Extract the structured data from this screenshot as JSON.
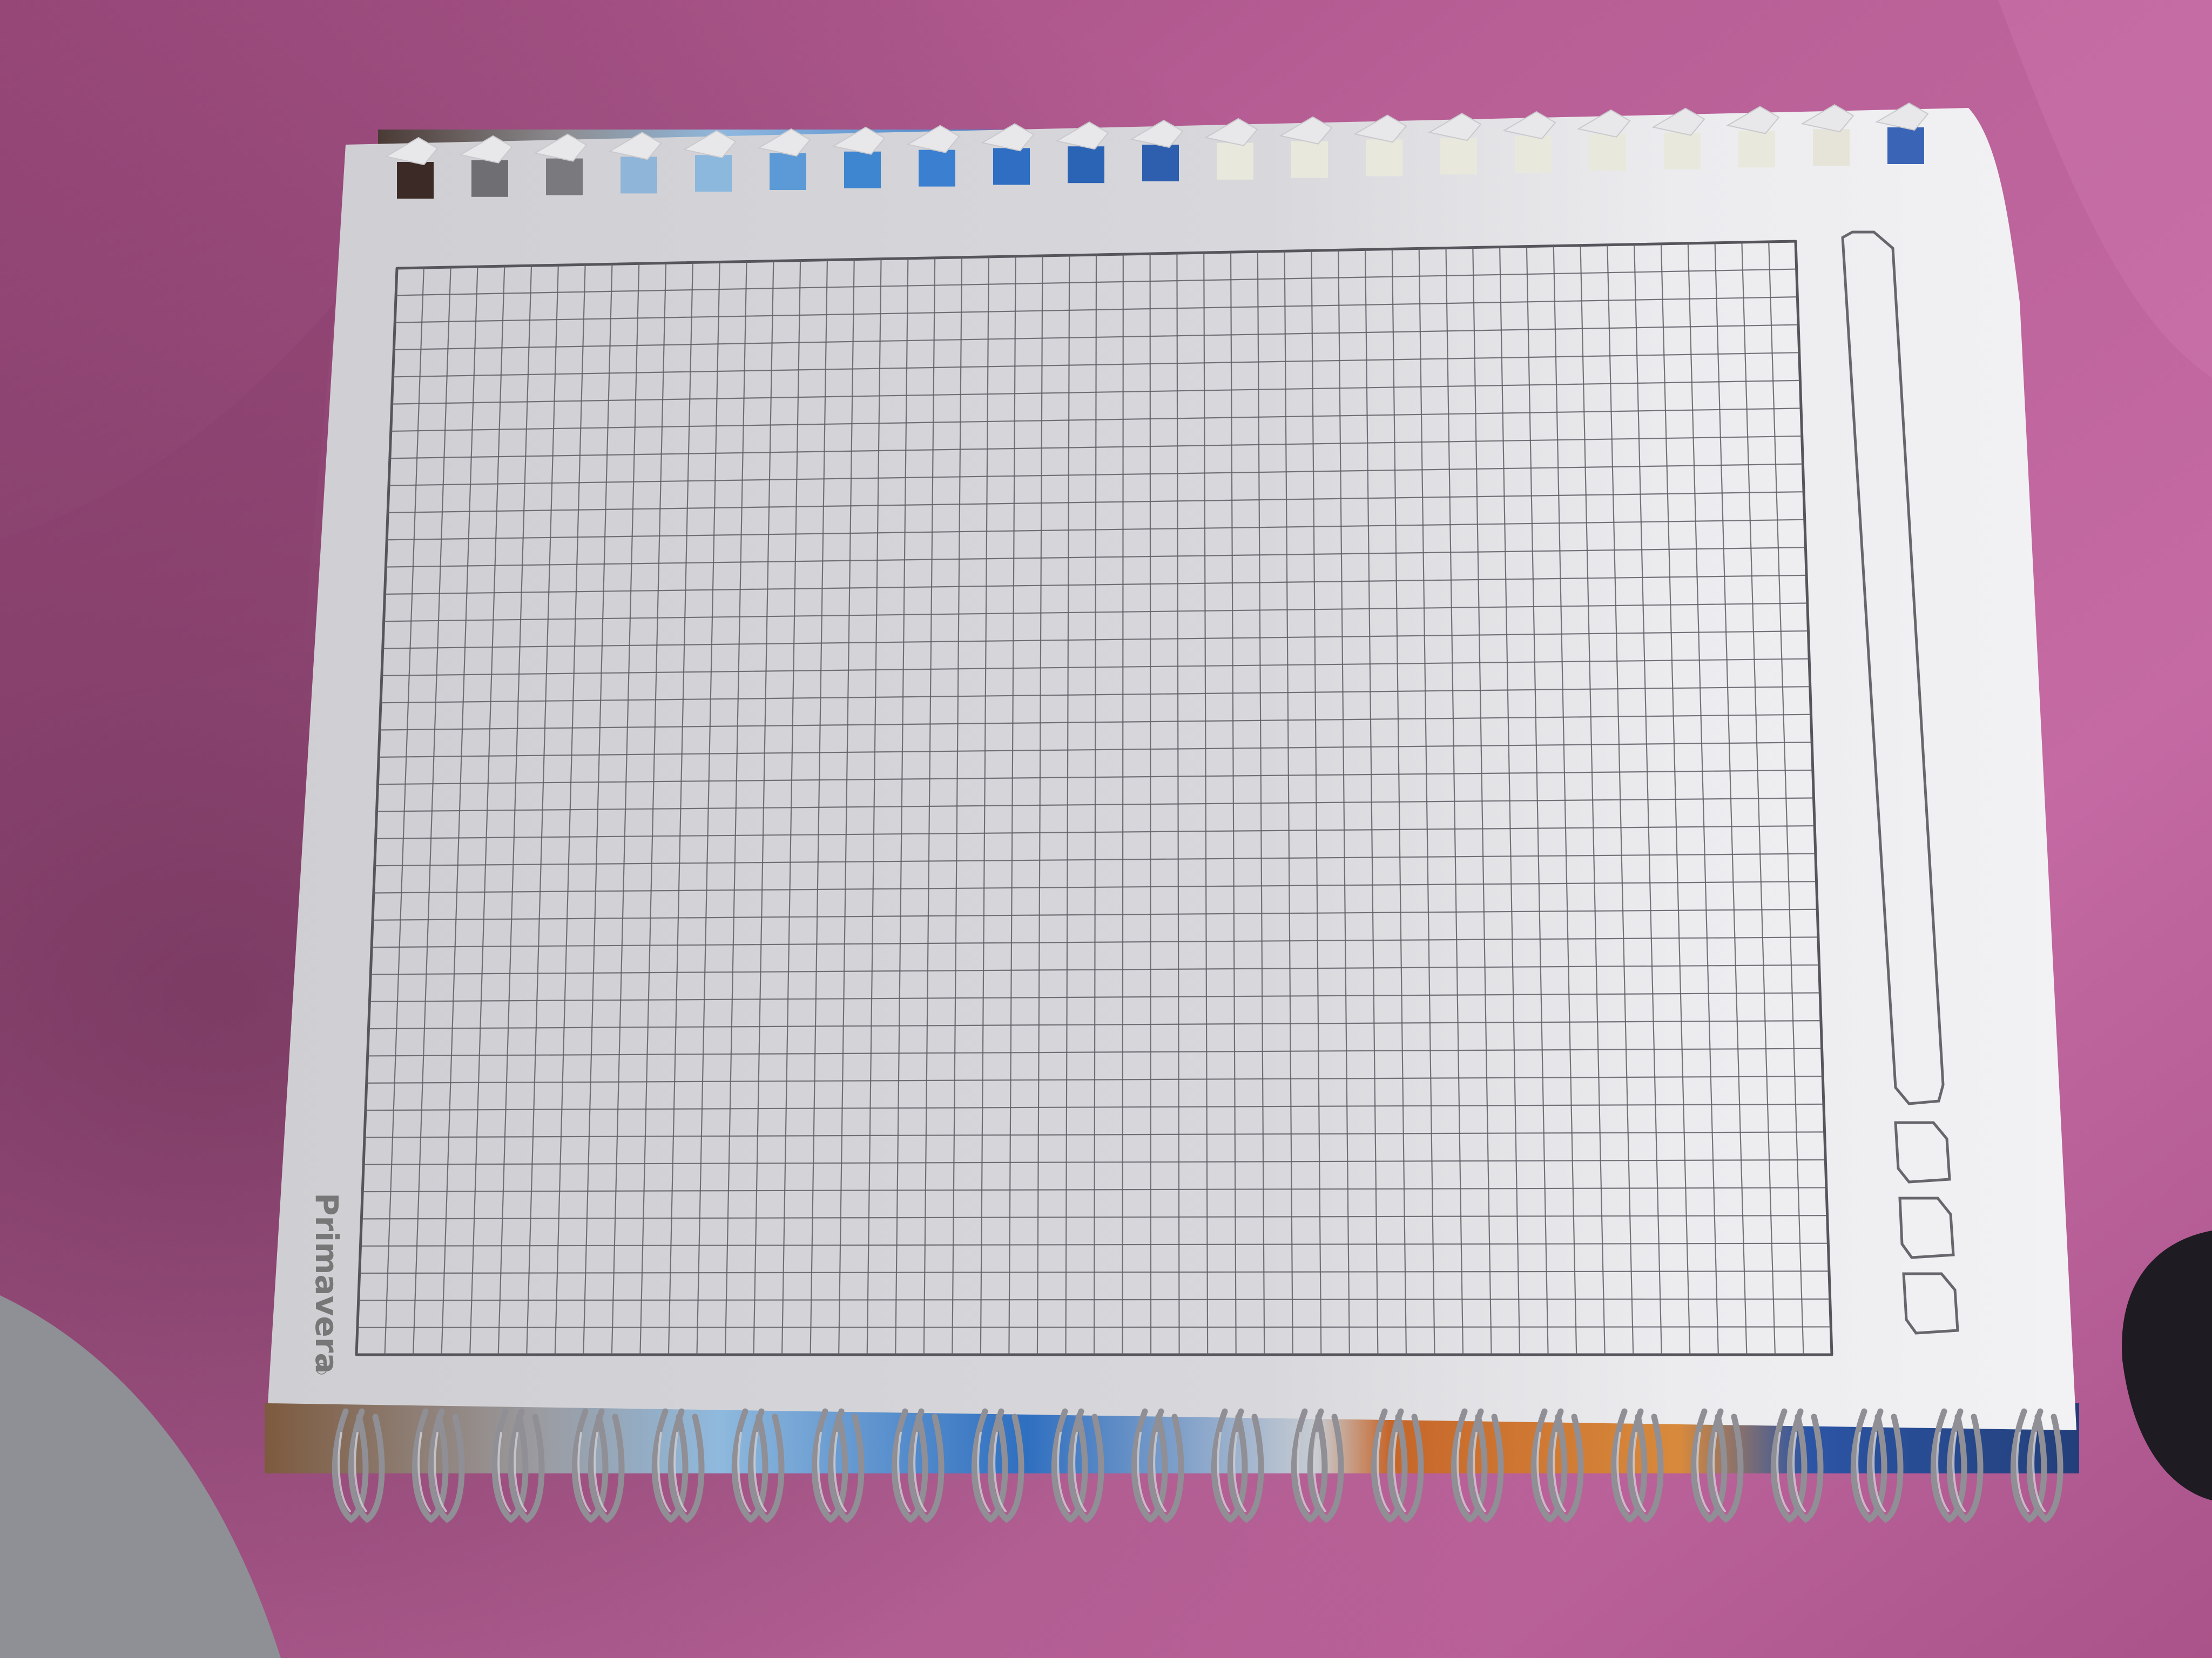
{
  "photo": {
    "subject": "grid-paper-notebook-page",
    "colors": {
      "fabric": "#b25c91",
      "fabric_shadow": "#6e3157",
      "paper": "#d9d9dc",
      "paper_light": "#efeff1",
      "grid_line": "#5c5c62",
      "cover_blue": "#2f5fa8",
      "cover_orange": "#c6662a",
      "spiral_wire": "#9a9aa0"
    }
  },
  "notebook": {
    "brand": "Primavera",
    "registered_mark": "®",
    "sidebar_boxes": [
      "title-bar",
      "box-1",
      "box-2",
      "box-3"
    ]
  }
}
